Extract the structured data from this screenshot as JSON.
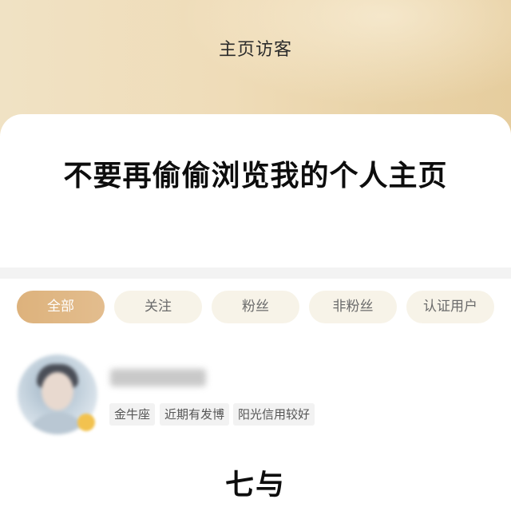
{
  "header": {
    "title": "主页访客"
  },
  "banner": {
    "headline": "不要再偷偷浏览我的个人主页"
  },
  "filters": {
    "active_index": 0,
    "tabs": [
      {
        "label": "全部"
      },
      {
        "label": "关注"
      },
      {
        "label": "粉丝"
      },
      {
        "label": "非粉丝"
      },
      {
        "label": "认证用户"
      }
    ]
  },
  "visitors": [
    {
      "nickname": "",
      "avatar": "blurred-user-photo",
      "badge": "vip-badge",
      "tags": [
        "金牛座",
        "近期有发博",
        "阳光信用较好"
      ]
    }
  ],
  "footer": {
    "brand": "七与"
  },
  "colors": {
    "header_gradient_start": "#f0e2c4",
    "header_gradient_end": "#e6cd9e",
    "active_tab": "#ddb27c",
    "inactive_tab": "#f7f3e8",
    "tag_background": "#f2f2f2"
  }
}
